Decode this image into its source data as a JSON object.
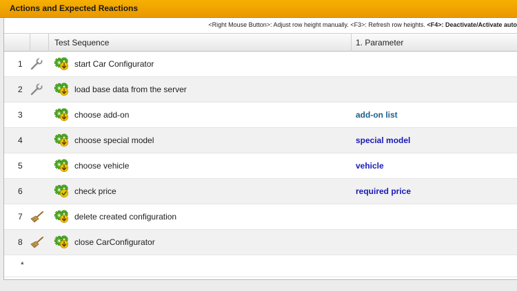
{
  "window": {
    "title": "Actions and Expected Reactions"
  },
  "hint": {
    "part1": "<Right Mouse Button>: Adjust row height manually. <F3>: Refresh row heights.",
    "part2": "<F4>: Deactivate/Activate auto"
  },
  "table": {
    "columns": [
      "",
      "",
      "Test Sequence",
      "1. Parameter"
    ],
    "rows": [
      {
        "num": "1",
        "row_icon": "wrench-icon",
        "action_icon": "gear-down-icon",
        "sequence": "start Car Configurator",
        "param": ""
      },
      {
        "num": "2",
        "row_icon": "wrench-icon",
        "action_icon": "gear-down-icon",
        "sequence": "load base data from the server",
        "param": ""
      },
      {
        "num": "3",
        "row_icon": "",
        "action_icon": "gear-down-icon",
        "sequence": "choose add-on",
        "param": "add-on list"
      },
      {
        "num": "4",
        "row_icon": "",
        "action_icon": "gear-down-icon",
        "sequence": "choose special model",
        "param": "special model"
      },
      {
        "num": "5",
        "row_icon": "",
        "action_icon": "gear-down-icon",
        "sequence": "choose vehicle",
        "param": "vehicle"
      },
      {
        "num": "6",
        "row_icon": "",
        "action_icon": "gear-check-icon",
        "sequence": "check price",
        "param": "required price"
      },
      {
        "num": "7",
        "row_icon": "broom-icon",
        "action_icon": "gear-down-icon",
        "sequence": "delete created configuration",
        "param": ""
      },
      {
        "num": "8",
        "row_icon": "broom-icon",
        "action_icon": "gear-down-icon",
        "sequence": "close CarConfigurator",
        "param": ""
      }
    ],
    "new_row_marker": "*"
  },
  "colors": {
    "title_bar": "#f0a500",
    "param_text": "#1a1ab8",
    "param_text_alt": "#1a5f8a",
    "gear_green": "#5cb82e",
    "arrow_yellow": "#f2c400"
  }
}
